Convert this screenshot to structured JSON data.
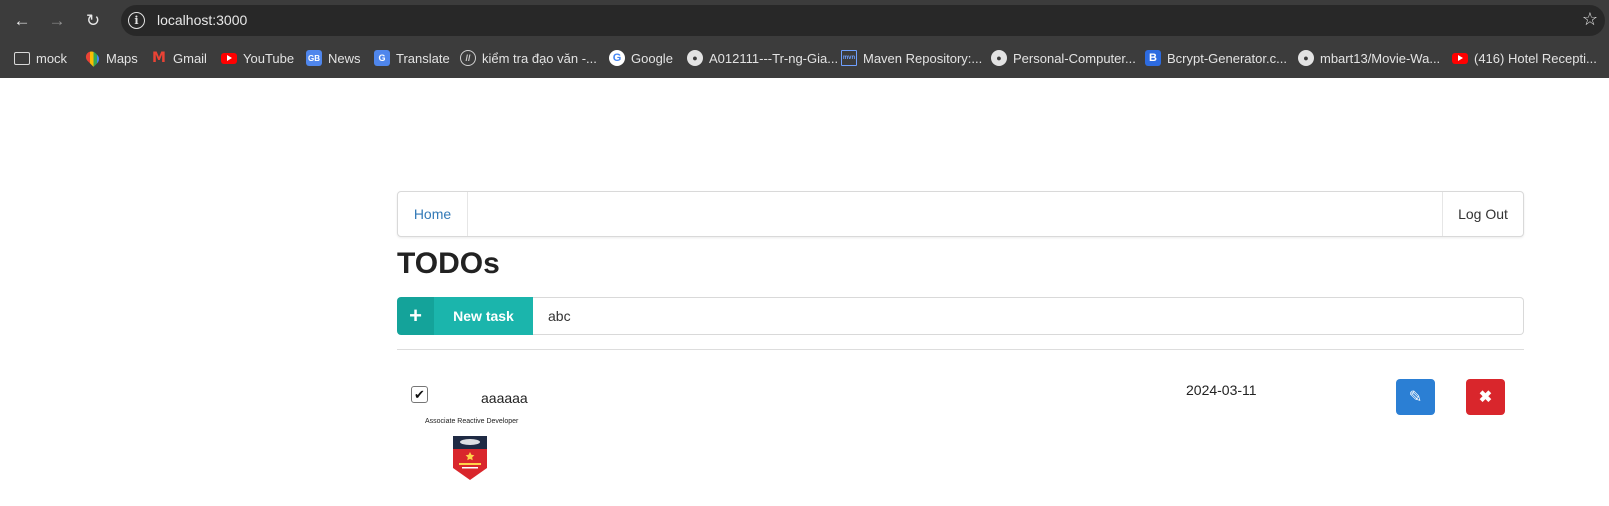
{
  "browser": {
    "url": "localhost:3000",
    "bookmarks": [
      {
        "label": "mock",
        "icon": "folder-icon"
      },
      {
        "label": "Maps",
        "icon": "maps-icon"
      },
      {
        "label": "Gmail",
        "icon": "gmail-icon"
      },
      {
        "label": "YouTube",
        "icon": "youtube-icon"
      },
      {
        "label": "News",
        "icon": "news-icon"
      },
      {
        "label": "Translate",
        "icon": "translate-icon"
      },
      {
        "label": "kiểm tra đạo văn -...",
        "icon": "plagiarism-icon"
      },
      {
        "label": "Google",
        "icon": "google-icon"
      },
      {
        "label": "A012111---Tr-ng-Gia...",
        "icon": "github-icon"
      },
      {
        "label": "Maven Repository:...",
        "icon": "maven-icon"
      },
      {
        "label": "Personal-Computer...",
        "icon": "github-icon"
      },
      {
        "label": "Bcrypt-Generator.c...",
        "icon": "bcrypt-icon"
      },
      {
        "label": "mbart13/Movie-Wa...",
        "icon": "github-icon"
      },
      {
        "label": "(416) Hotel Recepti...",
        "icon": "youtube-icon"
      }
    ]
  },
  "navbar": {
    "home_label": "Home",
    "logout_label": "Log Out"
  },
  "page": {
    "title": "TODOs"
  },
  "new_task": {
    "button_label": "New task",
    "input_value": "abc"
  },
  "todos": [
    {
      "checked": true,
      "title": "aaaaaa",
      "date": "2024-03-11",
      "attachment_caption": "Associate Reactive Developer"
    }
  ],
  "colors": {
    "accent_teal": "#1bb5ac",
    "edit_blue": "#2b7fd4",
    "delete_red": "#d9262c",
    "link_blue": "#337ab7"
  }
}
